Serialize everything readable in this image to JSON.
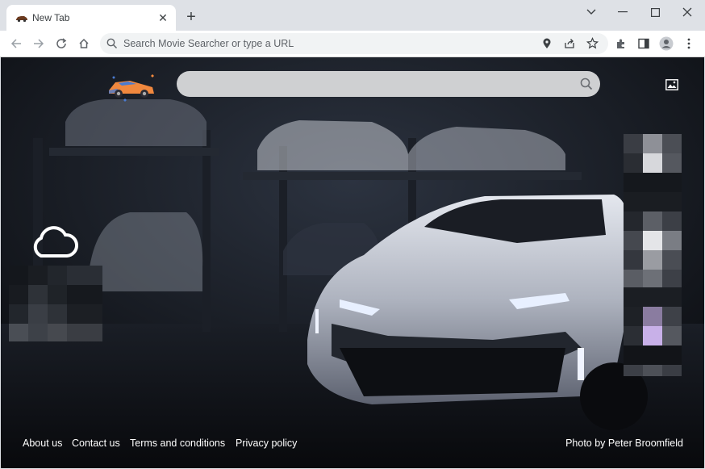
{
  "browser": {
    "tab": {
      "title": "New Tab",
      "favicon": "car-favicon",
      "close_icon": "close-icon"
    },
    "new_tab_icon": "plus-icon",
    "window_controls": [
      "minimize-icon",
      "maximize-icon",
      "close-icon",
      "chevron-down-icon"
    ],
    "toolbar": {
      "back_icon": "back-arrow-icon",
      "forward_icon": "forward-arrow-icon",
      "reload_icon": "reload-icon",
      "home_icon": "home-icon",
      "omnibox_placeholder": "Search Movie Searcher or type a URL",
      "right_icons": [
        "location-icon",
        "share-icon",
        "star-icon",
        "extensions-icon",
        "side-panel-icon",
        "profile-icon",
        "more-menu-icon"
      ]
    }
  },
  "page": {
    "logo": "car-logo",
    "search": {
      "placeholder": "",
      "icon": "search-icon"
    },
    "background_button_icon": "image-icon",
    "weather_icon": "cloud-icon",
    "footer": {
      "links": [
        "About us",
        "Contact us",
        "Terms and conditions",
        "Privacy policy"
      ],
      "photo_credit": "Photo by Peter Broomfield"
    }
  },
  "colors": {
    "tabstrip_bg": "#dee1e6",
    "toolbar_bg": "#ffffff",
    "omnibox_bg": "#f1f3f4",
    "page_bg": "#12151a",
    "search_bar_bg": "#cfd0d2",
    "footer_text": "#ffffff",
    "logo_orange": "#f0883e",
    "logo_blue": "#4a7bd0"
  }
}
